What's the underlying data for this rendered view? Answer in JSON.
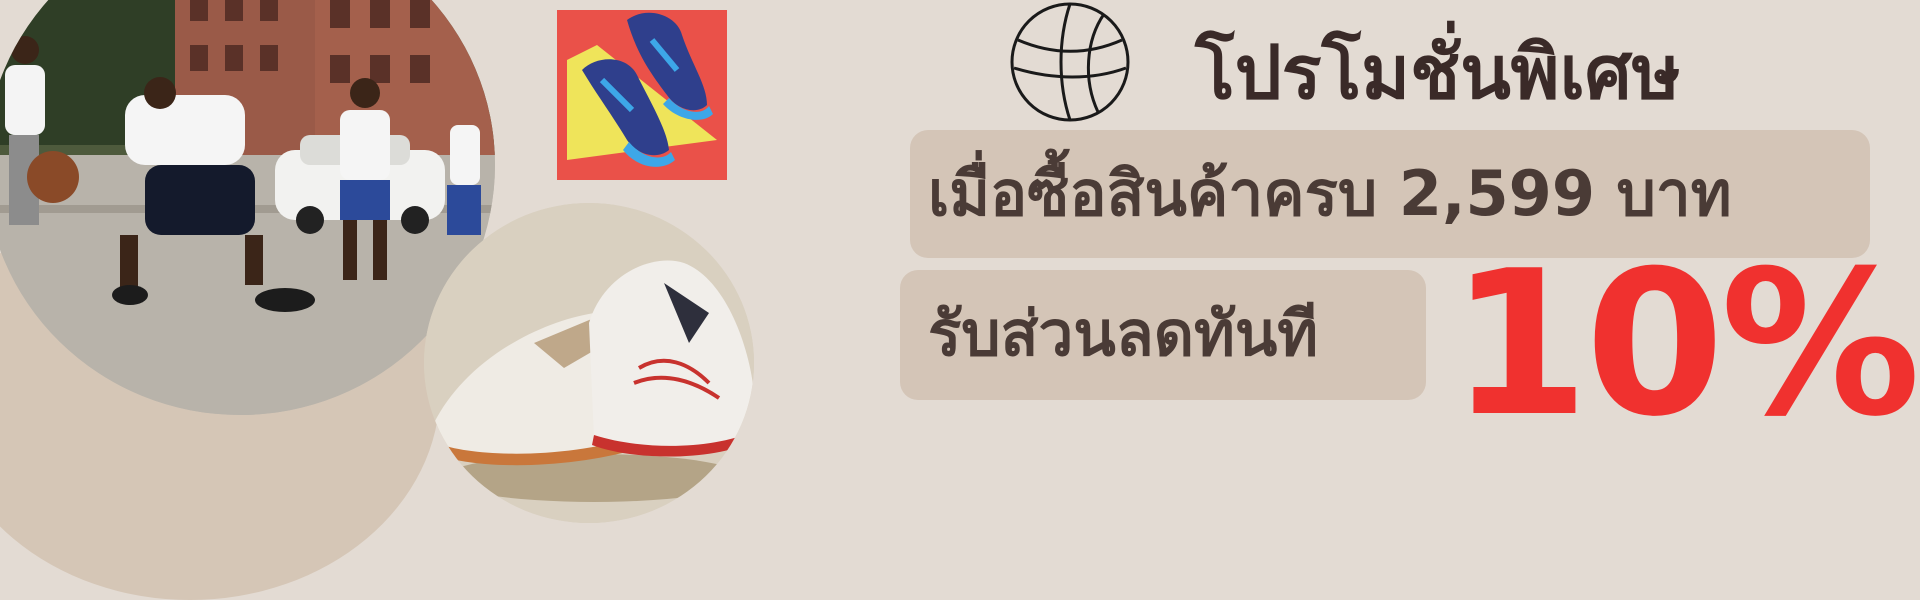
{
  "promo": {
    "title": "โปรโมชั่นพิเศษ",
    "condition": "เมื่อซื้อสินค้าครบ 2,599 บาท",
    "offer": "รับส่วนลดทันที",
    "discount": "10%"
  },
  "images": {
    "street_photo": "basketball-street-photo",
    "sneaker_photo": "white-sneaker-photo",
    "sneaker_icon": "sneaker-illustration-icon",
    "ball_icon": "basketball-outline-icon"
  },
  "colors": {
    "background": "#e3dbd3",
    "pill": "#d4c5b7",
    "title_text": "#3a2a28",
    "discount_text": "#f0312f",
    "tile": "#ea5149"
  }
}
